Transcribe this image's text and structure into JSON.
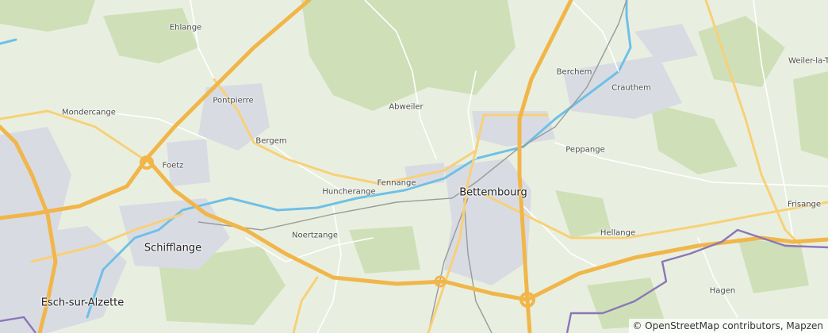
{
  "map": {
    "places": [
      {
        "id": "ehlange",
        "name": "Ehlange",
        "size": "small"
      },
      {
        "id": "pontpierre",
        "name": "Pontpierre",
        "size": "small"
      },
      {
        "id": "mondercange",
        "name": "Mondercange",
        "size": "small"
      },
      {
        "id": "bergem",
        "name": "Bergem",
        "size": "small"
      },
      {
        "id": "foetz",
        "name": "Foetz",
        "size": "small"
      },
      {
        "id": "abweiler",
        "name": "Abweiler",
        "size": "small"
      },
      {
        "id": "berchem",
        "name": "Berchem",
        "size": "small"
      },
      {
        "id": "crauthem",
        "name": "Crauthem",
        "size": "small"
      },
      {
        "id": "weiler",
        "name": "Weiler-la-T",
        "size": "small"
      },
      {
        "id": "peppange",
        "name": "Peppange",
        "size": "small"
      },
      {
        "id": "huncherange",
        "name": "Huncherange",
        "size": "small"
      },
      {
        "id": "fennange",
        "name": "Fennange",
        "size": "small"
      },
      {
        "id": "bettembourg",
        "name": "Bettembourg",
        "size": "large"
      },
      {
        "id": "frisange",
        "name": "Frisange",
        "size": "small"
      },
      {
        "id": "schifflange",
        "name": "Schifflange",
        "size": "large"
      },
      {
        "id": "noertzange",
        "name": "Noertzange",
        "size": "small"
      },
      {
        "id": "hellange",
        "name": "Hellange",
        "size": "small"
      },
      {
        "id": "esch",
        "name": "Esch-sur-Alzette",
        "size": "large"
      },
      {
        "id": "hagen",
        "name": "Hagen",
        "size": "small"
      }
    ],
    "attribution": "© OpenStreetMap contributors, Mapzen",
    "colors": {
      "land": "#e9efe0",
      "forest": "#cfe0b9",
      "urban": "#d9dbe3",
      "motorway": "#f1b64a",
      "primary_road": "#f6d178",
      "minor_road": "#ffffff",
      "railway": "#9a9a9a",
      "river": "#6fc0e6",
      "border": "#8a76b8"
    }
  }
}
